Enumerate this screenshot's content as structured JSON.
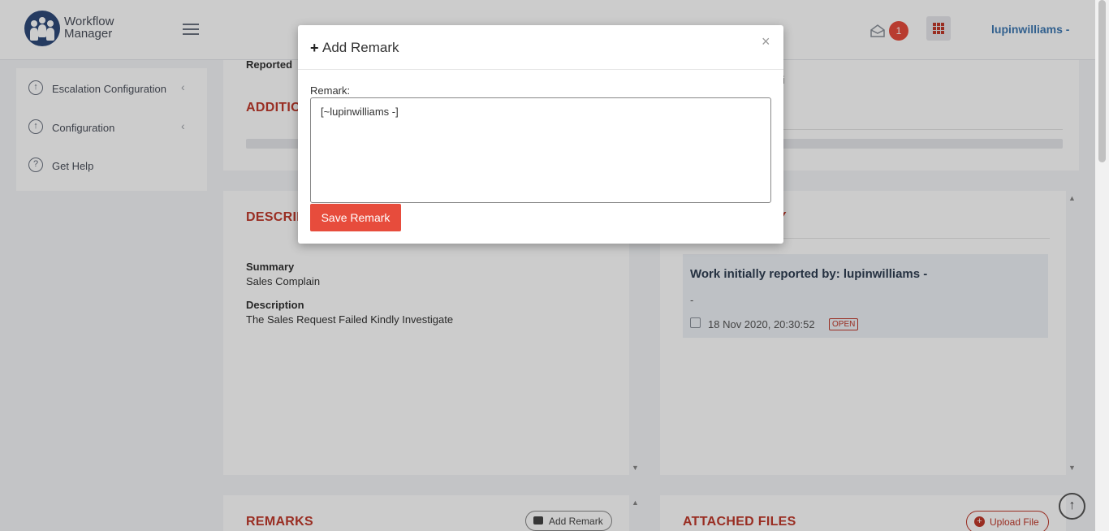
{
  "header": {
    "brand_line1": "Workflow",
    "brand_line2": "Manager",
    "notification_count": "1",
    "user_name": "lupinwilliams -"
  },
  "sidebar": {
    "items": [
      {
        "label": "Escalation Configuration",
        "icon": "arrow-up-circle-icon"
      },
      {
        "label": "Configuration",
        "icon": "arrow-up-circle-icon"
      },
      {
        "label": "Get Help",
        "icon": "help-circle-icon"
      }
    ]
  },
  "details": {
    "reported_label": "Reported",
    "additional_title": "ADDITIO",
    "right_fragment": "ki"
  },
  "description_card": {
    "title": "DESCRIPT",
    "summary_label": "Summary",
    "summary_value": "Sales Complain",
    "description_label": "Description",
    "description_value": "The Sales Request Failed Kindly Investigate"
  },
  "worklog_card": {
    "title_fragment": "Y",
    "entry_title": "Work initially reported by: lupinwilliams -",
    "entry_dash": "-",
    "entry_date": "18 Nov 2020, 20:30:52",
    "entry_status": "OPEN"
  },
  "remarks_card": {
    "title": "REMARKS",
    "add_button": "Add Remark"
  },
  "files_card": {
    "title": "ATTACHED FILES",
    "upload_button": "Upload File"
  },
  "modal": {
    "title": "Add Remark",
    "close_symbol": "×",
    "field_label": "Remark:",
    "remark_value": "[~lupinwilliams -]",
    "save_button": "Save Remark"
  },
  "colors": {
    "accent_red": "#e74c3c",
    "title_red": "#c0392b",
    "user_blue": "#3e78b2"
  }
}
